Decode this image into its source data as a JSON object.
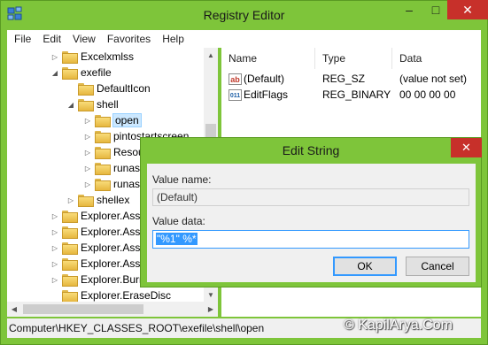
{
  "window": {
    "title": "Registry Editor",
    "minimize": "–",
    "maximize": "□",
    "close": "✕"
  },
  "menu": [
    "File",
    "Edit",
    "View",
    "Favorites",
    "Help"
  ],
  "tree": {
    "items": [
      {
        "label": "Excelxmlss",
        "arrow": "▷",
        "depth": 0
      },
      {
        "label": "exefile",
        "arrow": "◢",
        "depth": 0
      },
      {
        "label": "DefaultIcon",
        "arrow": "",
        "depth": 1
      },
      {
        "label": "shell",
        "arrow": "◢",
        "depth": 1
      },
      {
        "label": "open",
        "arrow": "▷",
        "depth": 2,
        "selected": true
      },
      {
        "label": "pintostartscreen",
        "arrow": "▷",
        "depth": 2
      },
      {
        "label": "ResourceHacker",
        "arrow": "▷",
        "depth": 2
      },
      {
        "label": "runas",
        "arrow": "▷",
        "depth": 2
      },
      {
        "label": "runasu",
        "arrow": "▷",
        "depth": 2
      },
      {
        "label": "shellex",
        "arrow": "▷",
        "depth": 1
      },
      {
        "label": "Explorer.Asso",
        "arrow": "▷",
        "depth": -1
      },
      {
        "label": "Explorer.Asso",
        "arrow": "▷",
        "depth": -1
      },
      {
        "label": "Explorer.Asso",
        "arrow": "▷",
        "depth": -1
      },
      {
        "label": "Explorer.Asso",
        "arrow": "▷",
        "depth": -1
      },
      {
        "label": "Explorer.Burn",
        "arrow": "▷",
        "depth": -1
      },
      {
        "label": "Explorer.EraseDisc",
        "arrow": "",
        "depth": -1
      }
    ]
  },
  "list": {
    "columns": [
      "Name",
      "Type",
      "Data"
    ],
    "rows": [
      {
        "icon": "string-value-icon",
        "icon_text": "ab",
        "name": "(Default)",
        "type": "REG_SZ",
        "data": "(value not set)"
      },
      {
        "icon": "binary-value-icon",
        "icon_text": "011",
        "name": "EditFlags",
        "type": "REG_BINARY",
        "data": "00 00 00 00"
      }
    ]
  },
  "dialog": {
    "title": "Edit String",
    "close": "✕",
    "value_name_label": "Value name:",
    "value_name": "(Default)",
    "value_data_label": "Value data:",
    "value_data": "\"%1\" %*",
    "ok": "OK",
    "cancel": "Cancel"
  },
  "status_bar": "Computer\\HKEY_CLASSES_ROOT\\exefile\\shell\\open",
  "watermark": "© KapilArya.Com",
  "colors": {
    "frame": "#7ec53a",
    "close_button": "#c7302a",
    "selection": "#3399ff"
  }
}
